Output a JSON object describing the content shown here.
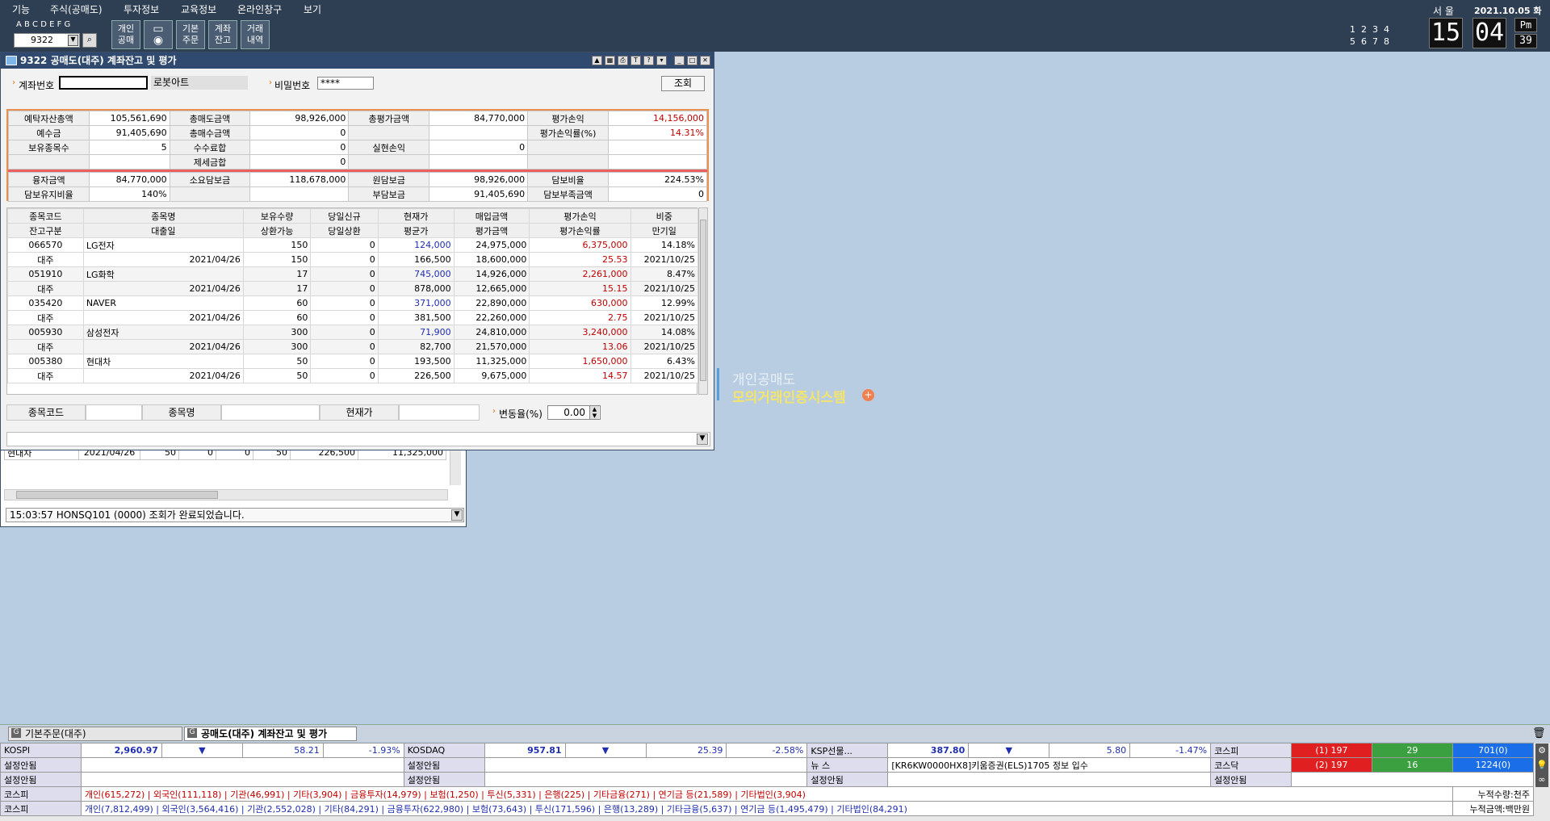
{
  "menu": [
    "기능",
    "주식(공매도)",
    "투자정보",
    "교육정보",
    "온라인창구",
    "보기"
  ],
  "toolbar": {
    "letters": "A B C D E F G",
    "code": "9322",
    "btn1": "개인\n공매",
    "btn3": "기본\n주문",
    "btn4": "계좌\n잔고",
    "btn5": "거래\n내역"
  },
  "clock": {
    "city": "서 울",
    "date": "2021.10.05 화",
    "hour": "15",
    "min": "04",
    "ampm": "Pm",
    "sec": "39",
    "nums1": "1  2  3  4",
    "nums2": "5  6  7  8"
  },
  "main": {
    "title": "9322 공매도(대주) 계좌잔고 및 평가",
    "acct_label": "계좌번호",
    "acct_name": "로봇아트",
    "pw_label": "비밀번호",
    "pw_value": "****",
    "query_btn": "조회",
    "summary": [
      [
        "예탁자산총액",
        "105,561,690",
        "총매도금액",
        "98,926,000",
        "총평가금액",
        "84,770,000",
        "평가손익",
        "14,156,000"
      ],
      [
        "예수금",
        "91,405,690",
        "총매수금액",
        "0",
        "",
        "",
        "평가손익률(%)",
        "14.31%"
      ],
      [
        "보유종목수",
        "5",
        "수수료합",
        "0",
        "실현손익",
        "0",
        "",
        ""
      ],
      [
        "",
        "",
        "제세금합",
        "0",
        "",
        "",
        "",
        ""
      ]
    ],
    "summary2": [
      [
        "융자금액",
        "84,770,000",
        "소요담보금",
        "118,678,000",
        "원담보금",
        "98,926,000",
        "담보비율",
        "224.53%"
      ],
      [
        "담보유지비율",
        "140%",
        "",
        "",
        "부담보금",
        "91,405,690",
        "담보부족금액",
        "0"
      ]
    ],
    "headers1": [
      "종목코드",
      "종목명",
      "보유수량",
      "당일신규",
      "현재가",
      "매입금액",
      "평가손익",
      "비중"
    ],
    "headers2": [
      "잔고구분",
      "대출일",
      "상환가능",
      "당일상환",
      "평균가",
      "평가금액",
      "평가손익률",
      "만기일"
    ],
    "rows": [
      {
        "code": "066570",
        "name": "LG전자",
        "qty": "150",
        "new": "0",
        "price": "124,000",
        "buy": "24,975,000",
        "pl": "6,375,000",
        "weight": "14.18%",
        "kind": "대주",
        "date": "2021/04/26",
        "repay": "150",
        "today": "0",
        "avg": "166,500",
        "eval": "18,600,000",
        "rate": "25.53",
        "exp": "2021/10/25"
      },
      {
        "code": "051910",
        "name": "LG화학",
        "qty": "17",
        "new": "0",
        "price": "745,000",
        "buy": "14,926,000",
        "pl": "2,261,000",
        "weight": "8.47%",
        "kind": "대주",
        "date": "2021/04/26",
        "repay": "17",
        "today": "0",
        "avg": "878,000",
        "eval": "12,665,000",
        "rate": "15.15",
        "exp": "2021/10/25"
      },
      {
        "code": "035420",
        "name": "NAVER",
        "qty": "60",
        "new": "0",
        "price": "371,000",
        "buy": "22,890,000",
        "pl": "630,000",
        "weight": "12.99%",
        "kind": "대주",
        "date": "2021/04/26",
        "repay": "60",
        "today": "0",
        "avg": "381,500",
        "eval": "22,260,000",
        "rate": "2.75",
        "exp": "2021/10/25"
      },
      {
        "code": "005930",
        "name": "삼성전자",
        "qty": "300",
        "new": "0",
        "price": "71,900",
        "buy": "24,810,000",
        "pl": "3,240,000",
        "weight": "14.08%",
        "kind": "대주",
        "date": "2021/04/26",
        "repay": "300",
        "today": "0",
        "avg": "82,700",
        "eval": "21,570,000",
        "rate": "13.06",
        "exp": "2021/10/25"
      },
      {
        "code": "005380",
        "name": "현대차",
        "qty": "50",
        "new": "0",
        "price": "193,500",
        "buy": "11,325,000",
        "pl": "1,650,000",
        "weight": "6.43%",
        "kind": "대주",
        "date": "2021/04/26",
        "repay": "50",
        "today": "0",
        "avg": "226,500",
        "eval": "9,675,000",
        "rate": "14.57",
        "exp": "2021/10/25"
      }
    ],
    "bottom": {
      "code_label": "종목코드",
      "name_label": "종목명",
      "price_label": "현재가",
      "chg_label": "변동율(%)",
      "chg_value": "0.00"
    }
  },
  "back": {
    "row": [
      "현대차",
      "2021/04/26",
      "50",
      "0",
      "0",
      "50",
      "226,500",
      "11,325,000"
    ],
    "status": "15:03:57 HONSQ101 (0000) 조회가 완료되었습니다."
  },
  "watermark": {
    "line1": "개인공매도",
    "line2": "모의거래인증시스템"
  },
  "tasks": [
    "기본주문(대주)",
    "공매도(대주) 계좌잔고 및 평가"
  ],
  "market": {
    "kospi": [
      "KOSPI",
      "2,960.97",
      "▼",
      "58.21",
      "-1.93%"
    ],
    "kosdaq": [
      "KOSDAQ",
      "957.81",
      "▼",
      "25.39",
      "-2.58%"
    ],
    "ksp": [
      "KSP선물...",
      "387.80",
      "▼",
      "5.80",
      "-1.47%"
    ],
    "unset": "설정안됨",
    "news_label": "뉴  스",
    "news": "[KR6KW0000HX8]키움증권(ELS)1705 정보 입수",
    "kospi_lbl": "코스피",
    "kosdaq_lbl": "코스닥",
    "adv1": [
      "(1) 197",
      "29",
      "701(0)"
    ],
    "adv2": [
      "(2) 197",
      "16",
      "1224(0)"
    ],
    "flow1": "개인(615,272) | 외국인(111,118) | 기관(46,991) | 기타(3,904) | 금융투자(14,979) | 보험(1,250) | 투신(5,331) | 은행(225) | 기타금융(271) | 연기금 등(21,589) | 기타법인(3,904)",
    "flow2": "개인(7,812,499) | 외국인(3,564,416) | 기관(2,552,028) | 기타(84,291) | 금융투자(622,980) | 보험(73,643) | 투신(171,596) | 은행(13,289) | 기타금융(5,637) | 연기금 등(1,495,479) | 기타법인(84,291)",
    "acc1": "누적수량:천주",
    "acc2": "누적금액:백만원"
  },
  "colors": {
    "accent": "#2f4a6e",
    "up": "#c00000",
    "down": "#1f2fb0"
  }
}
